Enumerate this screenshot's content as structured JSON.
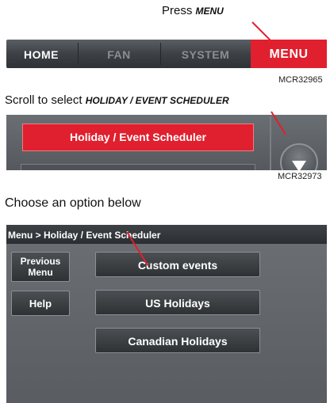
{
  "step1": {
    "instruction_prefix": "Press ",
    "instruction_target": "MENU",
    "tabs": [
      "HOME",
      "FAN",
      "SYSTEM",
      "MENU"
    ],
    "figure_code": "MCR32965"
  },
  "step2": {
    "instruction_prefix": "Scroll to select ",
    "instruction_target": "HOLIDAY / EVENT SCHEDULER",
    "selected_item": "Holiday / Event Scheduler",
    "scroll_button_icon": "scroll-down-arrow-icon",
    "figure_code": "MCR32973"
  },
  "step3": {
    "instruction": "Choose an option below",
    "breadcrumb": "Menu > Holiday / Event Scheduler",
    "previous_label_line1": "Previous",
    "previous_label_line2": "Menu",
    "help_label": "Help",
    "options": [
      "Custom events",
      "US Holidays",
      "Canadian Holidays"
    ]
  },
  "colors": {
    "accent_red": "#e0202e",
    "panel_gray": "#5d6166",
    "button_dark": "#3a3d40"
  }
}
